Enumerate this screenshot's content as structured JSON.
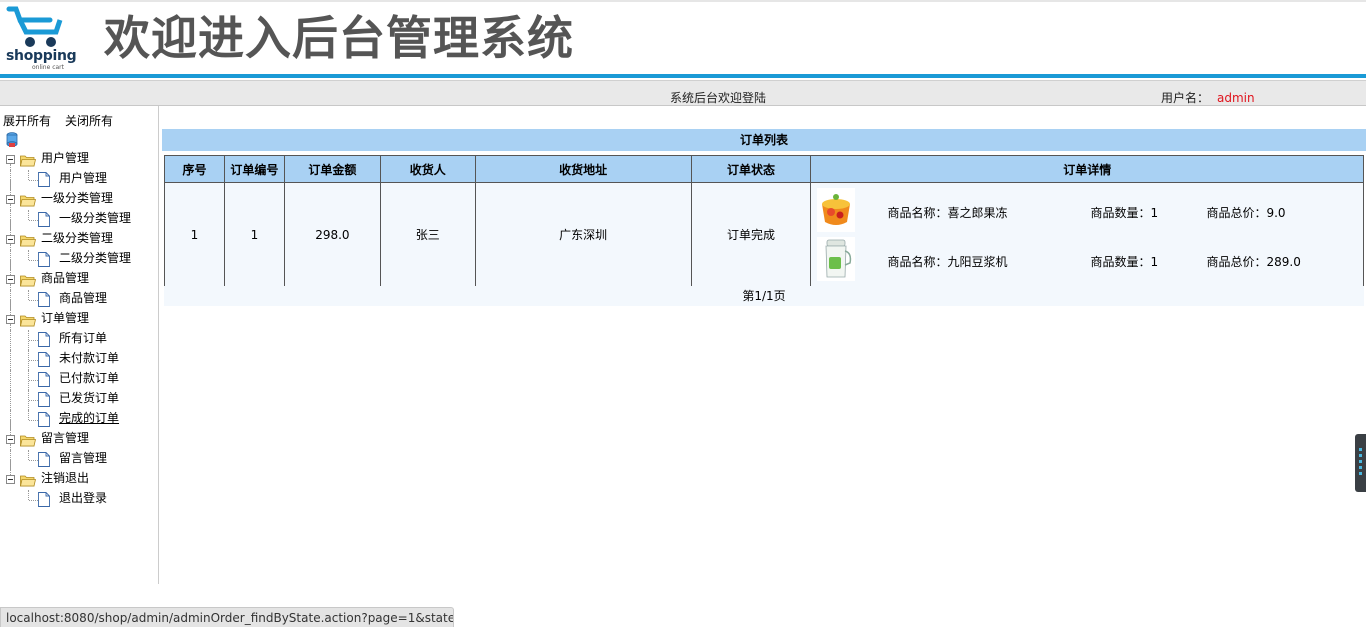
{
  "header": {
    "logo_text": "shopping",
    "logo_sub": "online cart",
    "site_title": "欢迎进入后台管理系统"
  },
  "statusbar": {
    "welcome": "系统后台欢迎登陆",
    "user_label": "用户名：",
    "user_name": "admin"
  },
  "sidebar": {
    "expand_all": "展开所有",
    "collapse_all": "关闭所有",
    "groups": [
      {
        "label": "用户管理",
        "children": [
          "用户管理"
        ]
      },
      {
        "label": "一级分类管理",
        "children": [
          "一级分类管理"
        ]
      },
      {
        "label": "二级分类管理",
        "children": [
          "二级分类管理"
        ]
      },
      {
        "label": "商品管理",
        "children": [
          "商品管理"
        ]
      },
      {
        "label": "订单管理",
        "children": [
          "所有订单",
          "未付款订单",
          "已付款订单",
          "已发货订单",
          "完成的订单"
        ]
      },
      {
        "label": "留言管理",
        "children": [
          "留言管理"
        ]
      },
      {
        "label": "注销退出",
        "children": [
          "退出登录"
        ]
      }
    ]
  },
  "main": {
    "list_title": "订单列表",
    "columns": [
      "序号",
      "订单编号",
      "订单金额",
      "收货人",
      "收货地址",
      "订单状态",
      "订单详情"
    ],
    "rows": [
      {
        "seq": "1",
        "order_no": "1",
        "amount": "298.0",
        "receiver": "张三",
        "address": "广东深圳",
        "status": "订单完成",
        "items": [
          {
            "name": "商品名称：喜之郎果冻",
            "qty": "商品数量：1",
            "total": "商品总价：9.0",
            "icon": "jelly-cup-icon"
          },
          {
            "name": "商品名称：九阳豆浆机",
            "qty": "商品数量：1",
            "total": "商品总价：289.0",
            "icon": "soymilk-maker-icon"
          }
        ]
      }
    ],
    "pager": "第1/1页"
  },
  "browser": {
    "status_url": "localhost:8080/shop/admin/adminOrder_findByState.action?page=1&state..."
  },
  "colors": {
    "accent_blue": "#1a9ad6",
    "header_cell": "#a9d1f3",
    "user_name": "#e0141e"
  }
}
